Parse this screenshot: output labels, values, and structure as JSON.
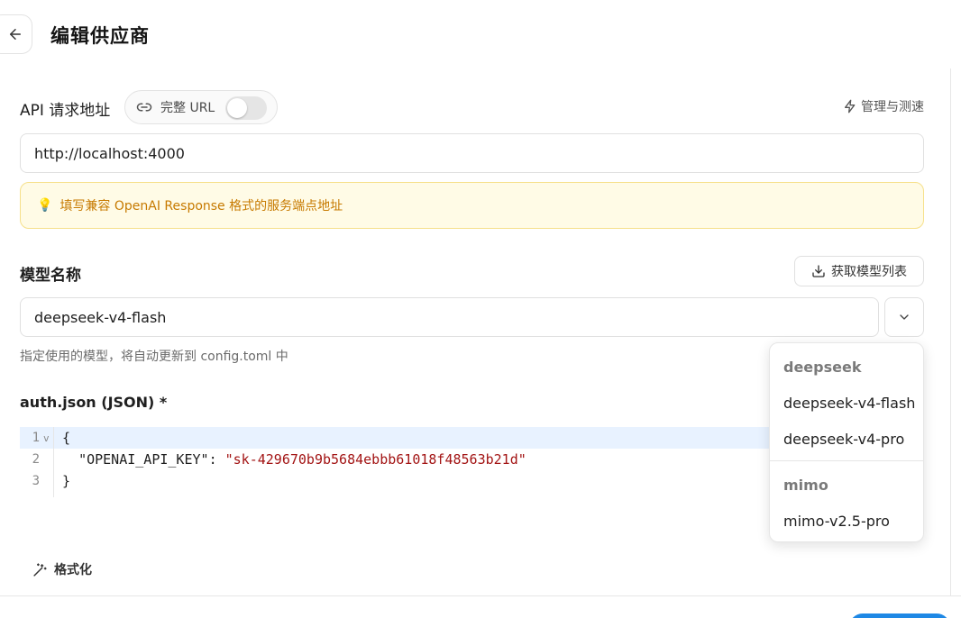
{
  "header": {
    "title": "编辑供应商",
    "back_icon": "arrow-left-icon"
  },
  "api": {
    "label": "API 请求地址",
    "full_url_label": "完整 URL",
    "full_url_enabled": false,
    "manage_label": "管理与测速",
    "url_value": "http://localhost:4000",
    "hint": "填写兼容 OpenAI Response 格式的服务端点地址"
  },
  "model": {
    "label": "模型名称",
    "fetch_label": "获取模型列表",
    "value": "deepseek-v4-flash",
    "help": "指定使用的模型，将自动更新到 config.toml 中"
  },
  "auth": {
    "label": "auth.json (JSON) *",
    "lines": [
      {
        "num": "1",
        "text": "{"
      },
      {
        "num": "2",
        "key": "\"OPENAI_API_KEY\"",
        "sep": ": ",
        "value": "\"sk-429670b9b5684ebbb61018f48563b21d\""
      },
      {
        "num": "3",
        "text": "}"
      }
    ],
    "format_label": "格式化"
  },
  "dropdown": {
    "groups": [
      {
        "label": "deepseek",
        "items": [
          "deepseek-v4-flash",
          "deepseek-v4-pro"
        ]
      },
      {
        "label": "mimo",
        "items": [
          "mimo-v2.5-pro"
        ]
      }
    ]
  },
  "colors": {
    "hint_text": "#c77a00",
    "hint_bg": "#fffbe6",
    "hint_border": "#f6e08a",
    "json_string": "#a31515",
    "active_line": "#e8f2ff",
    "primary": "#1e88e5"
  }
}
